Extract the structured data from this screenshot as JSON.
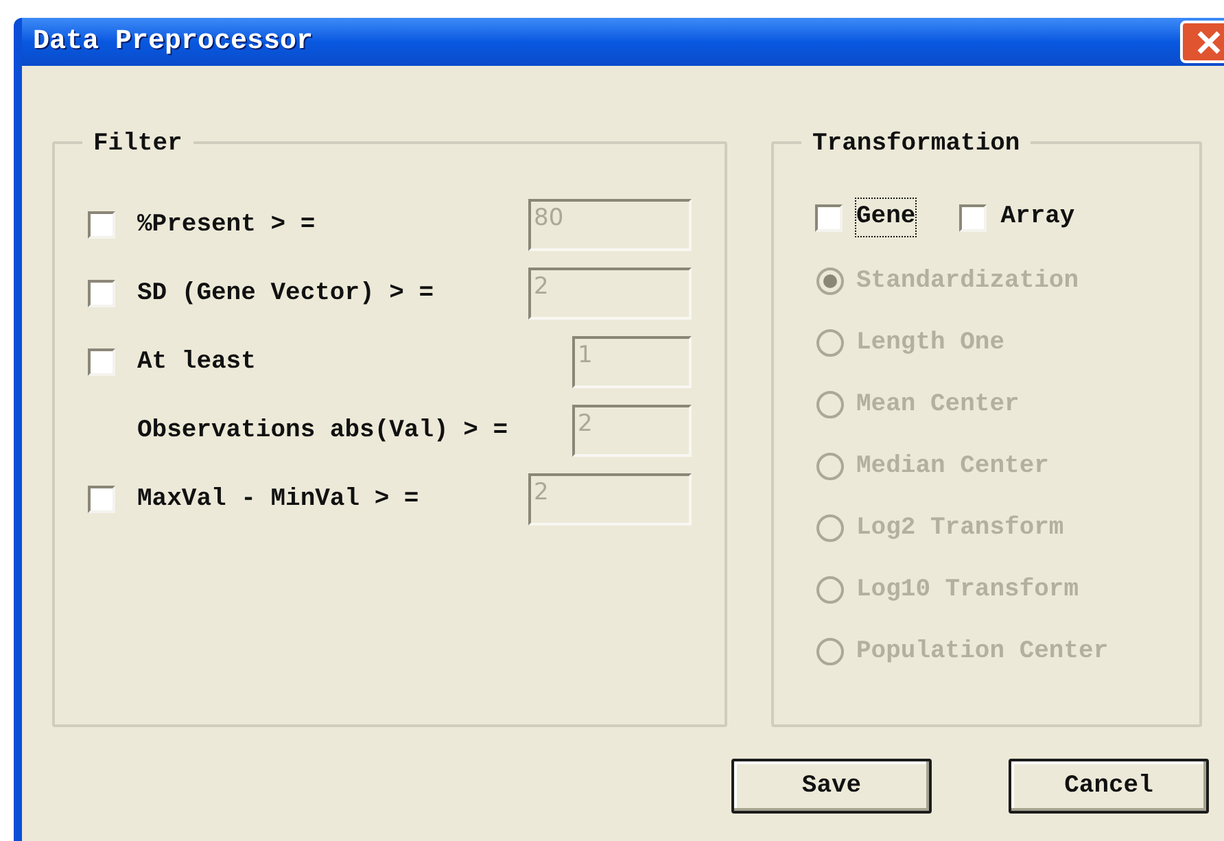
{
  "window": {
    "title": "Data Preprocessor"
  },
  "filter": {
    "title": "Filter",
    "rows": [
      {
        "kind": "check",
        "label": "%Present > =",
        "checked": false,
        "field": {
          "value": "80",
          "disabled": true
        }
      },
      {
        "kind": "check",
        "label": "SD (Gene Vector) > =",
        "checked": false,
        "field": {
          "value": "2",
          "disabled": true
        }
      },
      {
        "kind": "check-paired",
        "label": "At least",
        "checked": false,
        "field": {
          "value": "1",
          "disabled": true
        }
      },
      {
        "kind": "continuation",
        "label": "Observations abs(Val) > =",
        "field": {
          "value": "2",
          "disabled": true
        }
      },
      {
        "kind": "check",
        "label": "MaxVal - MinVal > =",
        "checked": false,
        "field": {
          "value": "2",
          "disabled": true
        }
      }
    ]
  },
  "transformation": {
    "title": "Transformation",
    "targets": [
      {
        "label": "Gene",
        "checked": false,
        "focused": true
      },
      {
        "label": "Array",
        "checked": false,
        "focused": false
      }
    ],
    "methods": [
      {
        "label": "Standardization",
        "selected": true,
        "disabled": true
      },
      {
        "label": "Length One",
        "selected": false,
        "disabled": true
      },
      {
        "label": "Mean Center",
        "selected": false,
        "disabled": true
      },
      {
        "label": "Median Center",
        "selected": false,
        "disabled": true
      },
      {
        "label": "Log2 Transform",
        "selected": false,
        "disabled": true
      },
      {
        "label": "Log10 Transform",
        "selected": false,
        "disabled": true
      },
      {
        "label": "Population Center",
        "selected": false,
        "disabled": true
      }
    ]
  },
  "buttons": [
    {
      "label": "Save"
    },
    {
      "label": "Cancel"
    }
  ]
}
